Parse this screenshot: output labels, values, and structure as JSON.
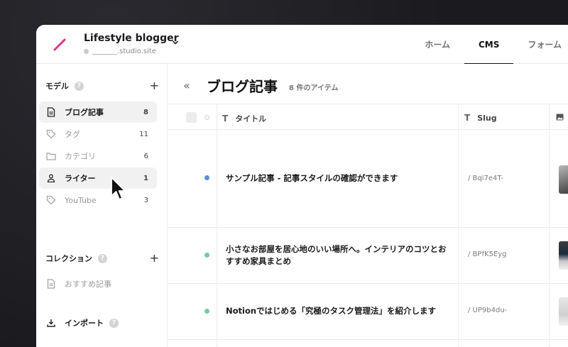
{
  "project": {
    "name": "Lifestyle blogger",
    "url": "_______.studio.site"
  },
  "tabs": [
    {
      "label": "ホーム"
    },
    {
      "label": "CMS"
    },
    {
      "label": "フォーム"
    }
  ],
  "sidebar": {
    "models_heading": "モデル",
    "models": [
      {
        "label": "ブログ記事",
        "count": "8",
        "icon": "document-icon"
      },
      {
        "label": "タグ",
        "count": "11",
        "icon": "tag-icon"
      },
      {
        "label": "カテゴリ",
        "count": "6",
        "icon": "folder-icon"
      },
      {
        "label": "ライター",
        "count": "1",
        "icon": "person-icon"
      },
      {
        "label": "YouTube",
        "count": "3",
        "icon": "tag-icon"
      }
    ],
    "collections_heading": "コレクション",
    "collections": [
      {
        "label": "おすすめ記事",
        "icon": "document-icon"
      }
    ],
    "import_label": "インポート",
    "help_glyph": "?",
    "plus_glyph": "+"
  },
  "main": {
    "collapse_glyph": "«",
    "title": "ブログ記事",
    "item_count": "8 件のアイテム",
    "columns": [
      {
        "label": "タイトル",
        "type_glyph": "T"
      },
      {
        "label": "Slug",
        "type_glyph": "T"
      }
    ],
    "rows": [
      {
        "title": "サンプル記事 - 記事スタイルの確認ができます",
        "slug": "/ Bqi7e4T-",
        "status_color": "#5b8fd6"
      },
      {
        "title": "小さなお部屋を居心地のいい場所へ。インテリアのコツとおすすめ家具まとめ",
        "slug": "/ BPfK5Eyg",
        "status_color": "#6fcf97"
      },
      {
        "title": "Notionではじめる「究極のタスク管理法」を紹介します",
        "slug": "/ UP9b4du-",
        "status_color": "#6fcf97"
      }
    ]
  },
  "colors": {
    "accent_logo": "#e0358f",
    "status_blue": "#5b8fd6",
    "status_green": "#6fcf97"
  }
}
